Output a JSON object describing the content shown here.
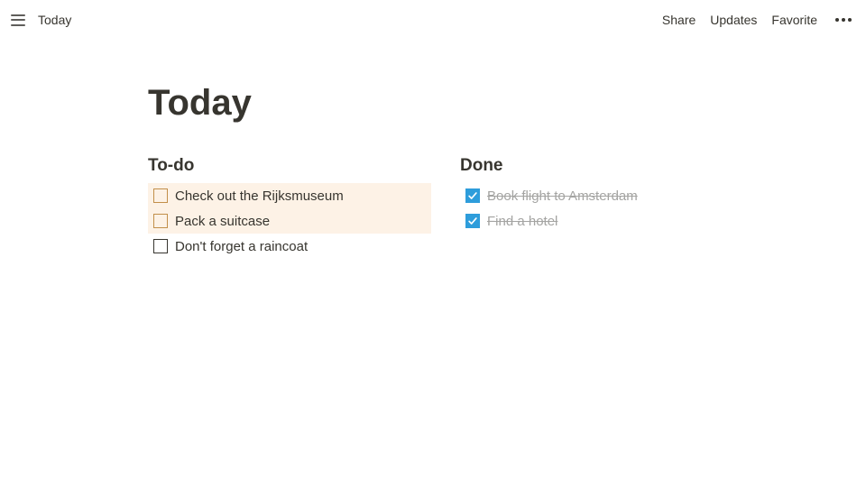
{
  "topbar": {
    "breadcrumb": "Today",
    "actions": {
      "share": "Share",
      "updates": "Updates",
      "favorite": "Favorite"
    }
  },
  "page": {
    "title": "Today"
  },
  "columns": {
    "todo": {
      "heading": "To-do",
      "items": [
        {
          "text": "Check out the Rijksmuseum",
          "highlighted": true
        },
        {
          "text": "Pack a suitcase",
          "highlighted": true
        },
        {
          "text": "Don't forget a raincoat",
          "highlighted": false
        }
      ]
    },
    "done": {
      "heading": "Done",
      "items": [
        {
          "text": "Book flight to Amsterdam"
        },
        {
          "text": "Find a hotel"
        }
      ]
    }
  }
}
